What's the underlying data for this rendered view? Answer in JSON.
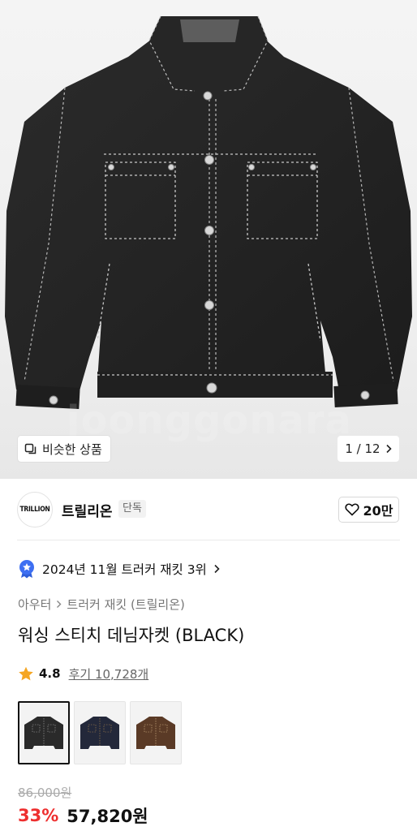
{
  "hero": {
    "watermark": "joonggonara",
    "similar_label": "비슷한 상품",
    "pager": "1 / 12"
  },
  "brand": {
    "logo_text": "TRILLION",
    "name": "트릴리온",
    "badge": "단독",
    "likes": "20만"
  },
  "ranking": {
    "text": "2024년 11월 트러커 재킷 3위"
  },
  "breadcrumb": {
    "level1": "아우터",
    "level2": "트러커 재킷 (트릴리온)"
  },
  "product": {
    "title": "워싱 스티치 데님자켓 (BLACK)",
    "rating": "4.8",
    "reviews": "후기 10,728개",
    "original_price": "86,000원",
    "discount": "33%",
    "price": "57,820원"
  },
  "variants": [
    {
      "name": "black",
      "color": "#2a2a2a"
    },
    {
      "name": "navy",
      "color": "#23283a"
    },
    {
      "name": "brown",
      "color": "#5a3a26"
    }
  ],
  "colors": {
    "accent_red": "#ee2f2f",
    "star": "#f5a623",
    "badge_blue": "#3d6ff2"
  },
  "icons": {
    "similar": "similar-items-icon",
    "pager_next": "chevron-right-icon",
    "like": "heart-icon",
    "rank": "ranking-medal-icon",
    "star": "star-icon"
  }
}
